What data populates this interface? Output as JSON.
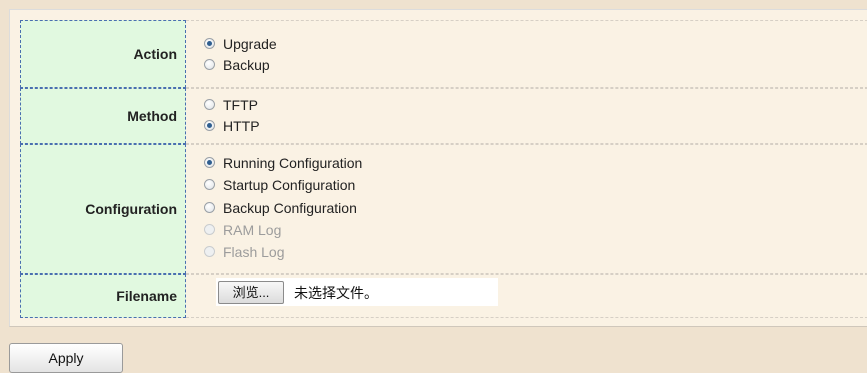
{
  "form": {
    "action": {
      "label": "Action",
      "options": [
        {
          "label": "Upgrade",
          "checked": true,
          "disabled": false
        },
        {
          "label": "Backup",
          "checked": false,
          "disabled": false
        }
      ]
    },
    "method": {
      "label": "Method",
      "options": [
        {
          "label": "TFTP",
          "checked": false,
          "disabled": false
        },
        {
          "label": "HTTP",
          "checked": true,
          "disabled": false
        }
      ]
    },
    "configuration": {
      "label": "Configuration",
      "options": [
        {
          "label": "Running Configuration",
          "checked": true,
          "disabled": false
        },
        {
          "label": "Startup Configuration",
          "checked": false,
          "disabled": false
        },
        {
          "label": "Backup Configuration",
          "checked": false,
          "disabled": false
        },
        {
          "label": "RAM Log",
          "checked": false,
          "disabled": true
        },
        {
          "label": "Flash Log",
          "checked": false,
          "disabled": true
        }
      ]
    },
    "filename": {
      "label": "Filename",
      "browse_label": "浏览...",
      "file_status": "未选择文件。"
    }
  },
  "apply_label": "Apply",
  "colors": {
    "label_cell_bg": "#e1f9e0",
    "panel_bg": "#faf2e4",
    "page_bg": "#efe2cf",
    "radio_selected": "#2f5e8f"
  }
}
